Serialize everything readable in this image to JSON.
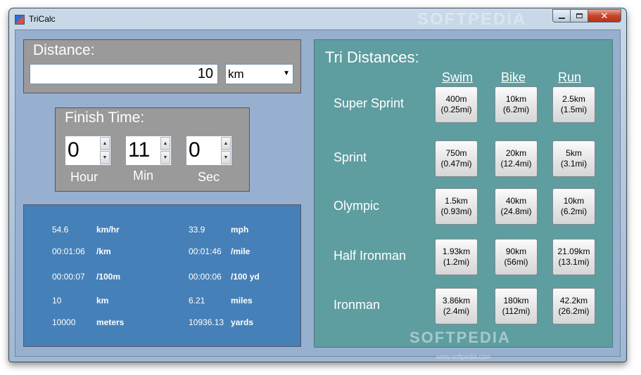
{
  "window": {
    "title": "TriCalc",
    "watermark": "SOFTPEDIA"
  },
  "distance": {
    "label": "Distance:",
    "value": "10",
    "unit": "km"
  },
  "finish_time": {
    "label": "Finish Time:",
    "hour": "0",
    "min": "11",
    "sec": "0",
    "hour_label": "Hour",
    "min_label": "Min",
    "sec_label": "Sec"
  },
  "results": [
    {
      "v1": "54.6",
      "u1": "km/hr",
      "v2": "33.9",
      "u2": "mph"
    },
    {
      "v1": "00:01:06",
      "u1": "/km",
      "v2": "00:01:46",
      "u2": "/mile"
    },
    {
      "v1": "00:00:07",
      "u1": "/100m",
      "v2": "00:00:06",
      "u2": "/100 yd"
    },
    {
      "v1": "10",
      "u1": "km",
      "v2": "6.21",
      "u2": "miles"
    },
    {
      "v1": "10000",
      "u1": "meters",
      "v2": "10936.13",
      "u2": "yards"
    }
  ],
  "tri": {
    "title": "Tri Distances:",
    "columns": [
      "Swim",
      "Bike",
      "Run"
    ],
    "rows": [
      {
        "name": "Super Sprint",
        "swim": [
          "400m",
          "(0.25mi)"
        ],
        "bike": [
          "10km",
          "(6.2mi)"
        ],
        "run": [
          "2.5km",
          "(1.5mi)"
        ]
      },
      {
        "name": "Sprint",
        "swim": [
          "750m",
          "(0.47mi)"
        ],
        "bike": [
          "20km",
          "(12.4mi)"
        ],
        "run": [
          "5km",
          "(3.1mi)"
        ]
      },
      {
        "name": "Olympic",
        "swim": [
          "1.5km",
          "(0.93mi)"
        ],
        "bike": [
          "40km",
          "(24.8mi)"
        ],
        "run": [
          "10km",
          "(6.2mi)"
        ]
      },
      {
        "name": "Half Ironman",
        "swim": [
          "1.93km",
          "(1.2mi)"
        ],
        "bike": [
          "90km",
          "(56mi)"
        ],
        "run": [
          "21.09km",
          "(13.1mi)"
        ]
      },
      {
        "name": "Ironman",
        "swim": [
          "3.86km",
          "(2.4mi)"
        ],
        "bike": [
          "180km",
          "(112mi)"
        ],
        "run": [
          "42.2km",
          "(26.2mi)"
        ]
      }
    ]
  },
  "watermark": {
    "main": "SOFTPEDIA",
    "sub": "www.softpedia.com"
  },
  "colors": {
    "results_panel": "#4680b8",
    "tri_panel": "#5e9da0",
    "input_panel": "#9a9a9a"
  }
}
